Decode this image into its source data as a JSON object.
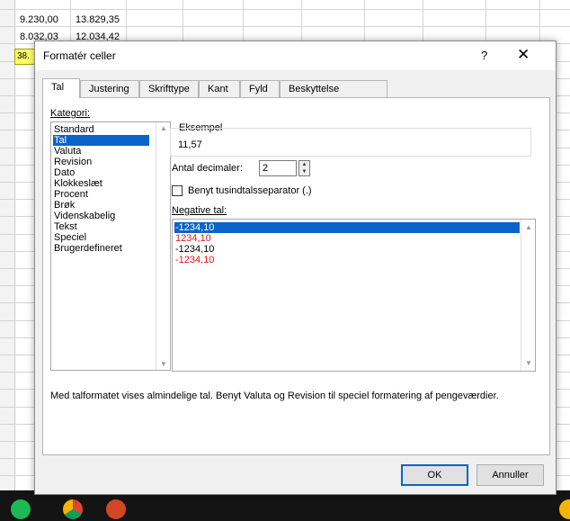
{
  "sheet": {
    "row1": [
      "9.230,00",
      "13.829,35"
    ],
    "row2": [
      "8.032,03",
      "12.034,42"
    ],
    "highlight_cell": "38."
  },
  "dialog": {
    "title": "Formatér celler",
    "help": "?",
    "close": "✕",
    "tabs": [
      "Tal",
      "Justering",
      "Skrifttype",
      "Kant",
      "Fyld",
      "Beskyttelse"
    ],
    "category_label": "Kategori:",
    "categories": [
      "Standard",
      "Tal",
      "Valuta",
      "Revision",
      "Dato",
      "Klokkeslæt",
      "Procent",
      "Brøk",
      "Videnskabelig",
      "Tekst",
      "Speciel",
      "Brugerdefineret"
    ],
    "selected_category": "Tal",
    "example_label": "Eksempel",
    "example_value": "11,57",
    "decimals_label": "Antal decimaler:",
    "decimals_value": "2",
    "separator_label": "Benyt tusindtalsseparator (.)",
    "separator_checked": false,
    "negative_label": "Negative tal:",
    "negative_options": [
      {
        "text": "-1234,10",
        "color": "#ffffff",
        "selected": true
      },
      {
        "text": "1234,10",
        "color": "#e01818",
        "selected": false
      },
      {
        "text": "-1234,10",
        "color": "#000000",
        "selected": false
      },
      {
        "text": "-1234,10",
        "color": "#e01818",
        "selected": false
      }
    ],
    "description": "Med talformatet vises almindelige tal. Benyt Valuta og Revision til speciel formatering af pengeværdier.",
    "ok": "OK",
    "cancel": "Annuller"
  },
  "colors": {
    "selection": "#0a63c9",
    "negative_red": "#e01818",
    "highlight_cell": "#ffff66"
  },
  "taskbar": {
    "icons": [
      "spotify-icon",
      "chrome-icon",
      "powerpoint-icon",
      "notification-icon"
    ]
  }
}
